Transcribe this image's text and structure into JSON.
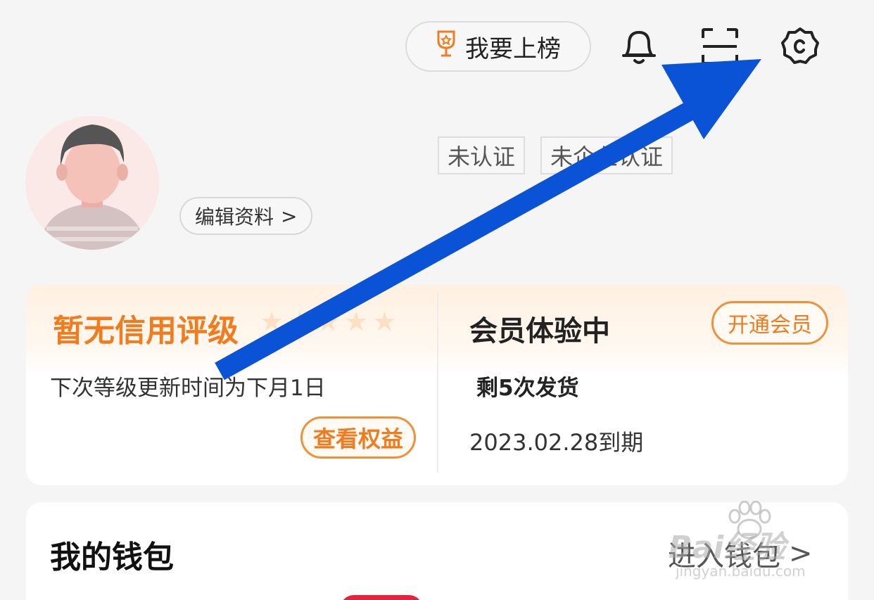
{
  "header": {
    "rank_label": "我要上榜",
    "icons": [
      "trophy-icon",
      "bell-icon",
      "scan-icon",
      "settings-icon"
    ]
  },
  "profile": {
    "tags": [
      "未认证",
      "未企业认证"
    ],
    "edit_label": "编辑资料",
    "edit_chevron": ">"
  },
  "credit_card": {
    "credit_title": "暂无信用评级",
    "stars": 5,
    "next_update": "下次等级更新时间为下月1日",
    "view_rights": "查看权益",
    "member_title": "会员体验中",
    "open_member": "开通会员",
    "remaining": "剩5次发货",
    "expire": "2023.02.28到期"
  },
  "wallet": {
    "title": "我的钱包",
    "enter_label": "进入钱包",
    "enter_chevron": ">"
  },
  "watermark": {
    "brand": "Bai经验",
    "url": "jingyan.baidu.com"
  },
  "colors": {
    "accent_orange": "#f07c1f",
    "annotation_arrow": "#0a52d6",
    "badge_red": "#e5223f"
  }
}
